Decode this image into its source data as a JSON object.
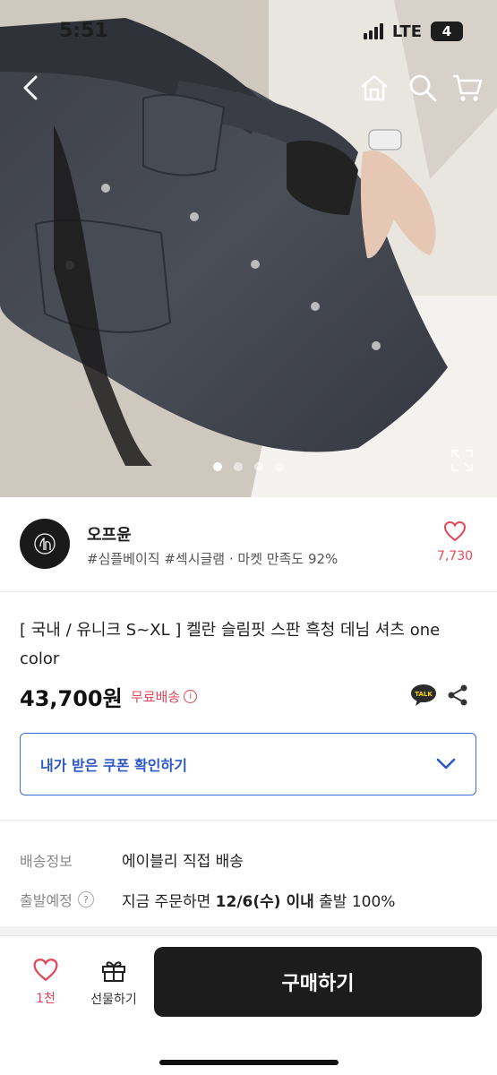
{
  "status_bar": {
    "time": "5:51",
    "network": "LTE",
    "battery": "4"
  },
  "hero": {
    "total_images": 4,
    "active_index": 0
  },
  "seller": {
    "name": "오프윤",
    "tags": "#심플베이직 #섹시글램 · 마켓 만족도 92%",
    "like_count": "7,730"
  },
  "product": {
    "title": "[ 국내 / 유니크 S~XL ] 켈란 슬림핏 스판 흑청 데님 셔츠 one color",
    "price": "43,700원",
    "shipping_badge": "무료배송",
    "talk_label": "TALK"
  },
  "coupon": {
    "label": "내가 받은 쿠폰 확인하기"
  },
  "delivery": {
    "shipping_label": "배송정보",
    "shipping_value": "에이블리 직접 배송",
    "departure_label": "출발예정",
    "departure_value_prefix": "지금 주문하면 ",
    "departure_value_bold": "12/6(수) 이내",
    "departure_value_suffix": " 출발 100%"
  },
  "bottom_bar": {
    "like_count": "1천",
    "gift_label": "선물하기",
    "buy_label": "구매하기"
  },
  "colors": {
    "accent_pink": "#e0485a",
    "accent_blue": "#2d58c8",
    "buy_button": "#1c1c1c"
  }
}
